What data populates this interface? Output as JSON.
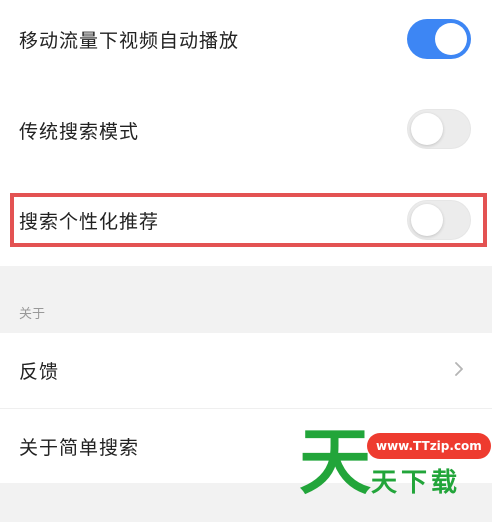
{
  "settings": {
    "items": [
      {
        "label": "移动流量下视频自动播放",
        "enabled": true
      },
      {
        "label": "传统搜索模式",
        "enabled": false
      },
      {
        "label": "搜索个性化推荐",
        "enabled": false
      }
    ]
  },
  "about": {
    "header": "关于",
    "items": [
      {
        "label": "反馈",
        "has_chevron": true
      },
      {
        "label": "关于简单搜索"
      }
    ]
  },
  "watermark": {
    "big_char": "天",
    "url": "www.TTzip.com",
    "subtitle": "天下载"
  },
  "colors": {
    "toggle_on": "#3d86f4",
    "toggle_off": "#ececec",
    "highlight": "#e35252",
    "watermark_green": "#22a53a",
    "watermark_red": "#ee3b2f"
  },
  "icons": {
    "chevron": "chevron-right-icon"
  }
}
